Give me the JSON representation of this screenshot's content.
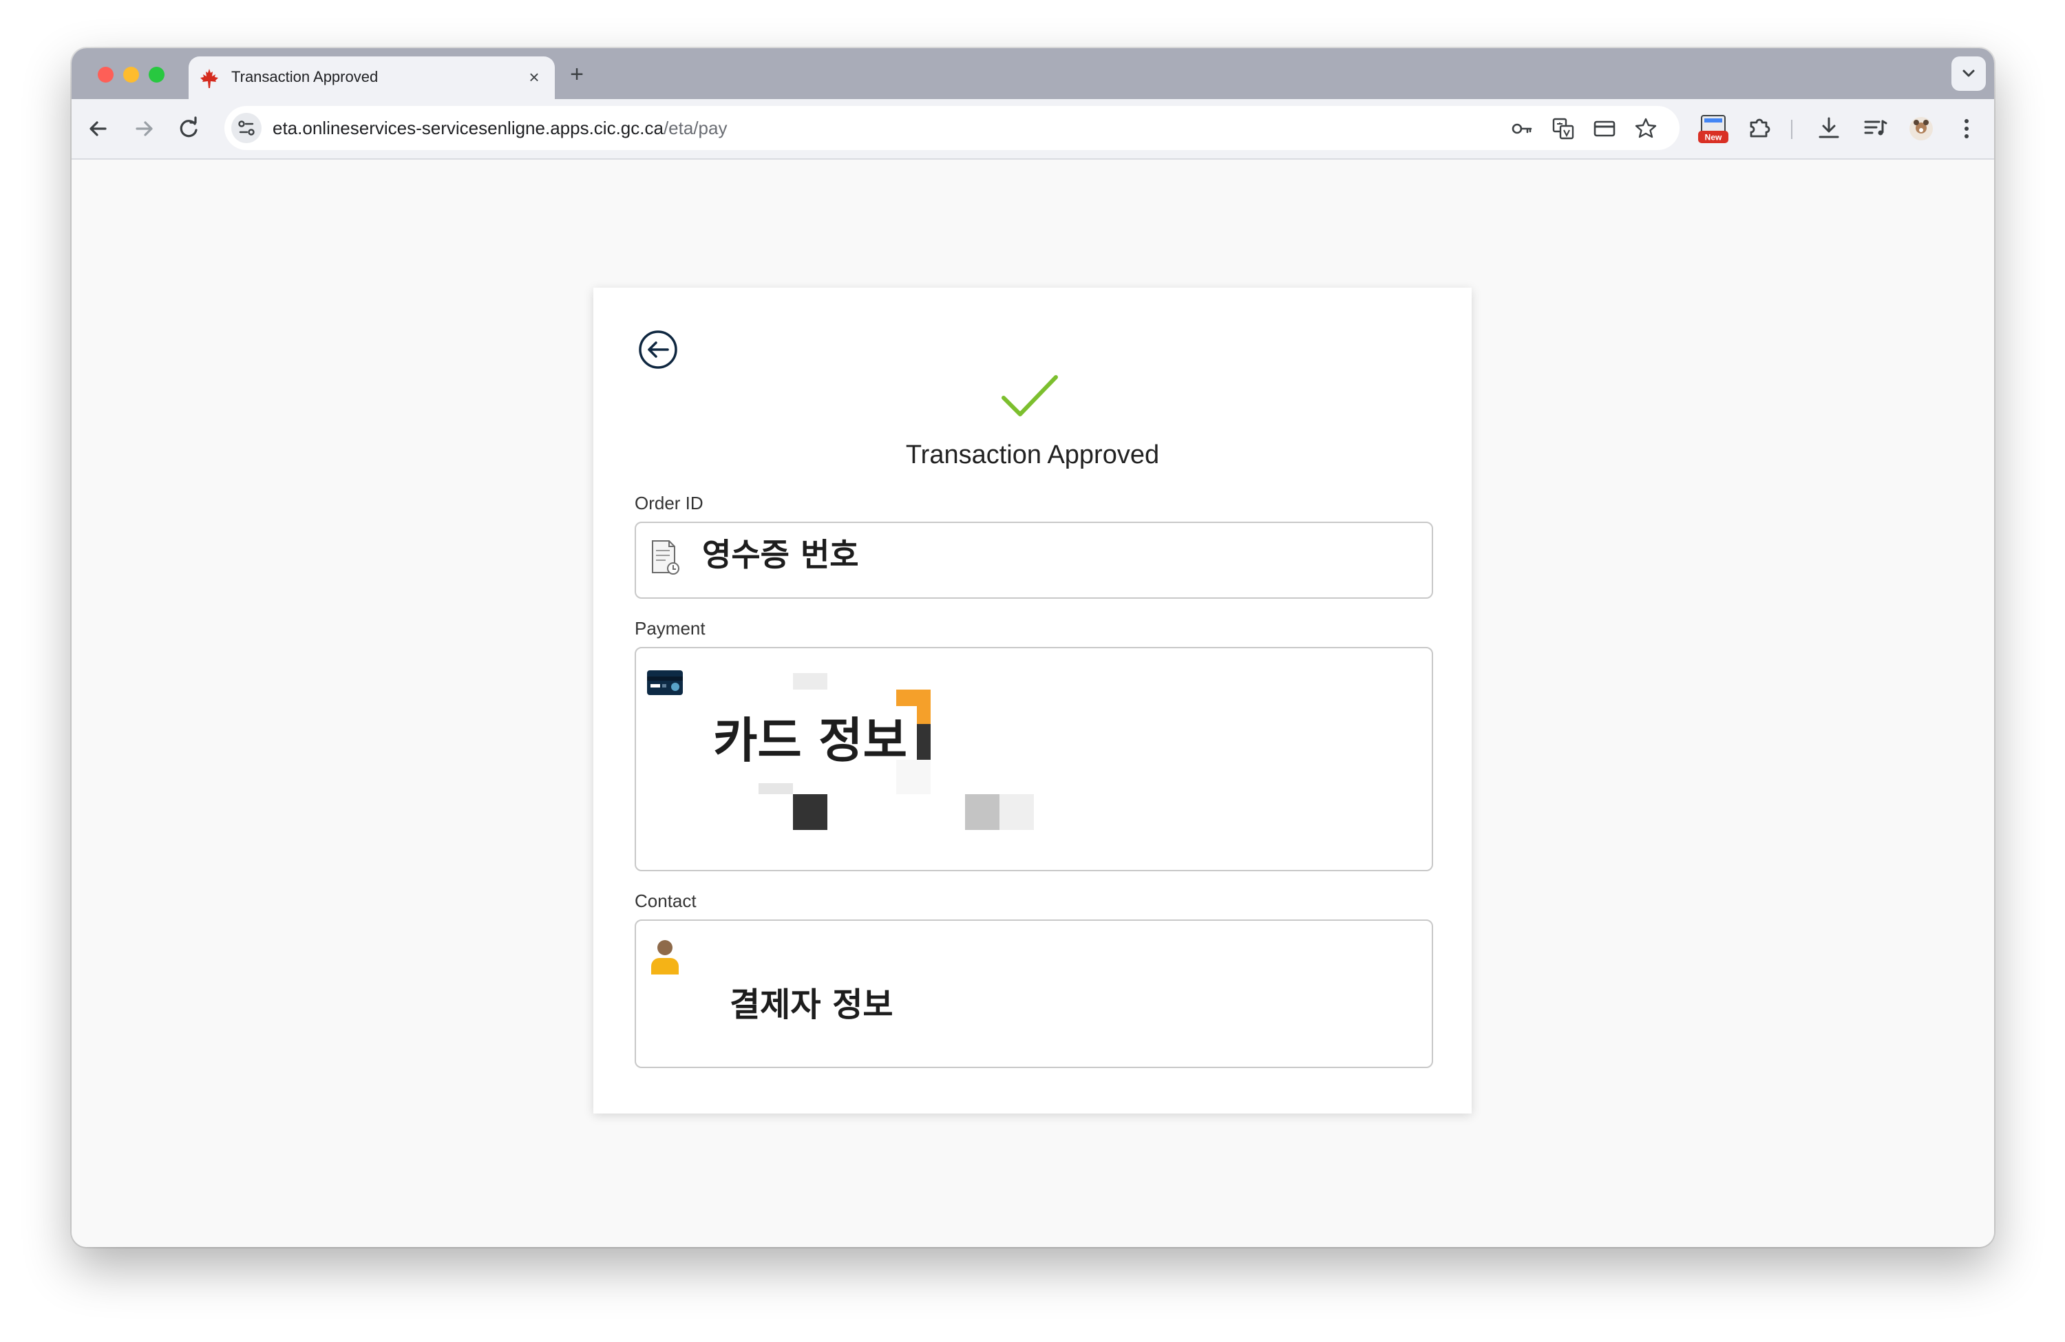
{
  "browser": {
    "tab_title": "Transaction Approved",
    "tab_close_glyph": "×",
    "new_tab_glyph": "+",
    "url_host": "eta.onlineservices-servicesenligne.apps.cic.gc.ca",
    "url_path": "/eta/pay",
    "extension_badge": "New",
    "icons": [
      "maple-leaf-favicon",
      "back-arrow-icon",
      "forward-arrow-icon",
      "reload-icon",
      "site-settings-icon",
      "password-key-icon",
      "translate-icon",
      "payment-card-icon",
      "bookmark-star-icon",
      "extension-new-icon",
      "extensions-puzzle-icon",
      "download-icon",
      "reading-list-icon",
      "profile-avatar-icon",
      "more-menu-icon"
    ]
  },
  "page": {
    "title": "Transaction Approved",
    "success_color": "#7cbf2e",
    "order": {
      "label": "Order ID",
      "value": "영수증 번호",
      "icon": "receipt-icon"
    },
    "payment": {
      "label": "Payment",
      "value": "카드 정보",
      "icon": "credit-card-icon"
    },
    "contact": {
      "label": "Contact",
      "value": "결제자 정보",
      "icon": "person-icon"
    }
  }
}
